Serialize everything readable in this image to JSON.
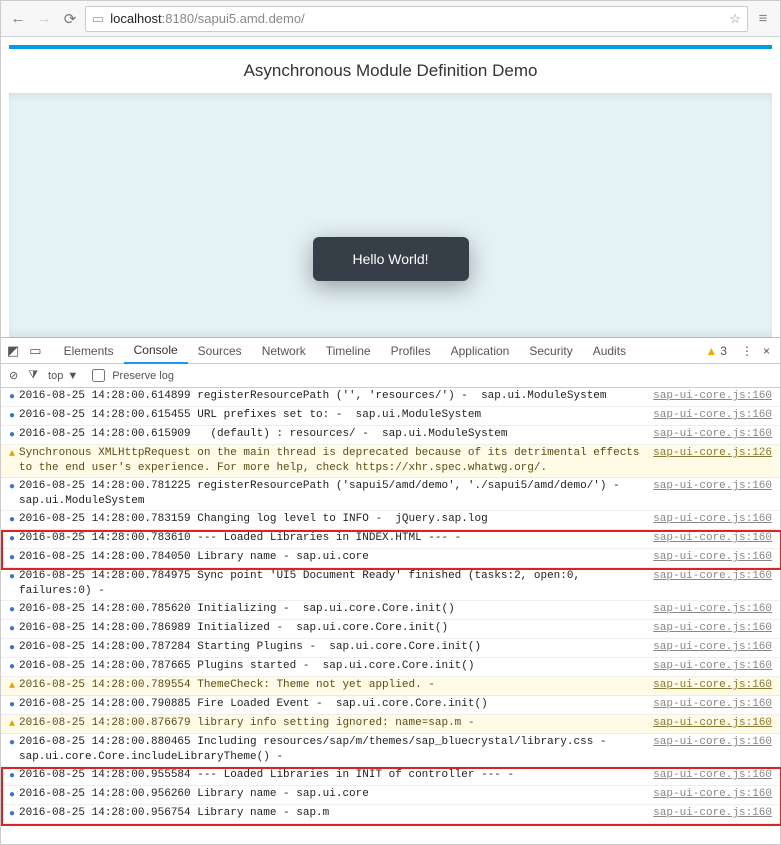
{
  "browser": {
    "url_host": "localhost",
    "url_rest": ":8180/sapui5.amd.demo/"
  },
  "page": {
    "title": "Asynchronous Module Definition Demo",
    "button_label": "Hello World!"
  },
  "devtools": {
    "tabs": [
      "Elements",
      "Console",
      "Sources",
      "Network",
      "Timeline",
      "Profiles",
      "Application",
      "Security",
      "Audits"
    ],
    "active_tab": "Console",
    "warn_count": "3",
    "filter_scope": "top",
    "preserve_label": "Preserve log"
  },
  "logs": [
    {
      "level": "info",
      "msg": "2016-08-25 14:28:00.614899 registerResourcePath ('', 'resources/') -  sap.ui.ModuleSystem",
      "src": "sap-ui-core.js:160"
    },
    {
      "level": "info",
      "msg": "2016-08-25 14:28:00.615455 URL prefixes set to: -  sap.ui.ModuleSystem",
      "src": "sap-ui-core.js:160"
    },
    {
      "level": "info",
      "msg": "2016-08-25 14:28:00.615909   (default) : resources/ -  sap.ui.ModuleSystem",
      "src": "sap-ui-core.js:160"
    },
    {
      "level": "warn",
      "msg": "Synchronous XMLHttpRequest on the main thread is deprecated because of its detrimental effects to the end user's experience. For more help, check https://xhr.spec.whatwg.org/.",
      "src": "sap-ui-core.js:126"
    },
    {
      "level": "info",
      "msg": "2016-08-25 14:28:00.781225 registerResourcePath ('sapui5/amd/demo', './sapui5/amd/demo/') -  sap.ui.ModuleSystem",
      "src": "sap-ui-core.js:160"
    },
    {
      "level": "info",
      "msg": "2016-08-25 14:28:00.783159 Changing log level to INFO -  jQuery.sap.log",
      "src": "sap-ui-core.js:160"
    },
    {
      "level": "info",
      "msg": "2016-08-25 14:28:00.783610 --- Loaded Libraries in INDEX.HTML --- - ",
      "src": "sap-ui-core.js:160"
    },
    {
      "level": "info",
      "msg": "2016-08-25 14:28:00.784050 Library name - sap.ui.core",
      "src": "sap-ui-core.js:160"
    },
    {
      "level": "info",
      "msg": "2016-08-25 14:28:00.784975 Sync point 'UI5 Document Ready' finished (tasks:2, open:0, failures:0) - ",
      "src": "sap-ui-core.js:160"
    },
    {
      "level": "info",
      "msg": "2016-08-25 14:28:00.785620 Initializing -  sap.ui.core.Core.init()",
      "src": "sap-ui-core.js:160"
    },
    {
      "level": "info",
      "msg": "2016-08-25 14:28:00.786989 Initialized -  sap.ui.core.Core.init()",
      "src": "sap-ui-core.js:160"
    },
    {
      "level": "info",
      "msg": "2016-08-25 14:28:00.787284 Starting Plugins -  sap.ui.core.Core.init()",
      "src": "sap-ui-core.js:160"
    },
    {
      "level": "info",
      "msg": "2016-08-25 14:28:00.787665 Plugins started -  sap.ui.core.Core.init()",
      "src": "sap-ui-core.js:160"
    },
    {
      "level": "warn",
      "msg": "2016-08-25 14:28:00.789554 ThemeCheck: Theme not yet applied. - ",
      "src": "sap-ui-core.js:160"
    },
    {
      "level": "info",
      "msg": "2016-08-25 14:28:00.790885 Fire Loaded Event -  sap.ui.core.Core.init()",
      "src": "sap-ui-core.js:160"
    },
    {
      "level": "warn",
      "msg": "2016-08-25 14:28:00.876679 library info setting ignored: name=sap.m - ",
      "src": "sap-ui-core.js:160"
    },
    {
      "level": "info",
      "msg": "2016-08-25 14:28:00.880465 Including resources/sap/m/themes/sap_bluecrystal/library.css -  sap.ui.core.Core.includeLibraryTheme() - ",
      "src": "sap-ui-core.js:160"
    },
    {
      "level": "info",
      "msg": "2016-08-25 14:28:00.955584 --- Loaded Libraries in INIT of controller --- - ",
      "src": "sap-ui-core.js:160"
    },
    {
      "level": "info",
      "msg": "2016-08-25 14:28:00.956260 Library name - sap.ui.core",
      "src": "sap-ui-core.js:160"
    },
    {
      "level": "info",
      "msg": "2016-08-25 14:28:00.956754 Library name - sap.m",
      "src": "sap-ui-core.js:160"
    }
  ]
}
